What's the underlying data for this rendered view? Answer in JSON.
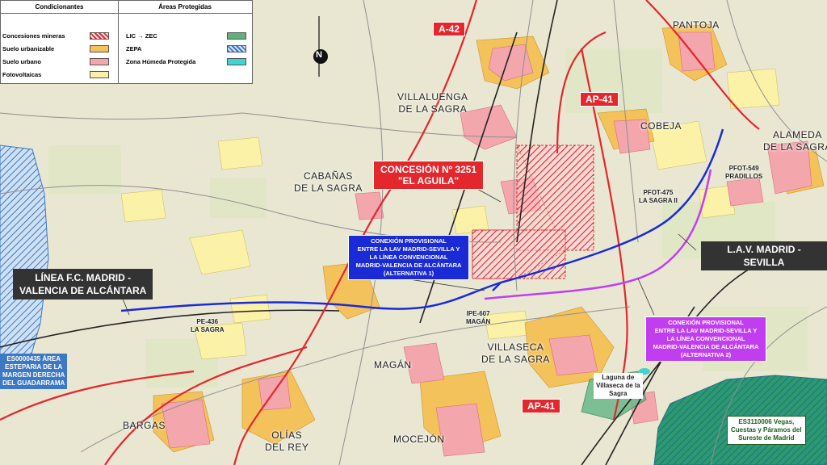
{
  "legend": {
    "header_left": "Condicionantes",
    "header_right": "Áreas Protegidas",
    "left_items": [
      {
        "label": "Concesiones mineras",
        "color": "#e4262d",
        "icon": "hatch-red"
      },
      {
        "label": "Suelo urbanizable",
        "color": "#f4c25a",
        "icon": "fill-orange"
      },
      {
        "label": "Suelo urbano",
        "color": "#f4a6ad",
        "icon": "fill-pink"
      },
      {
        "label": "Fotovoltaicas",
        "color": "#fbf2a8",
        "icon": "fill-yellow"
      }
    ],
    "right_items": [
      {
        "label": "LIC → ZEC",
        "color": "#5fb37a",
        "icon": "fill-green"
      },
      {
        "label": "ZEPA",
        "color": "#4f86c6",
        "icon": "hatch-blue"
      },
      {
        "label": "Zona Húmeda Protegida",
        "color": "#3fd3d3",
        "icon": "fill-cyan"
      }
    ]
  },
  "roads": {
    "a42": "A-42",
    "ap41_north": "AP-41",
    "ap41_south": "AP-41"
  },
  "towns": {
    "pantoja": "PANTOJA",
    "villaluenga": [
      "VILLALUENGA",
      "DE LA SAGRA"
    ],
    "cobeja": "COBEJA",
    "alameda": [
      "ALAMEDA",
      "DE LA SAGRA"
    ],
    "cabanas": [
      "CABAÑAS",
      "DE LA SAGRA"
    ],
    "magan": "MAGÁN",
    "villaseca": [
      "VILLASECA",
      "DE LA SAGRA"
    ],
    "bargas": "BARGAS",
    "olias": [
      "OLÍAS",
      "DEL REY"
    ],
    "mocejon": "MOCEJÓN"
  },
  "concession": {
    "title": "CONCESIÓN Nº 3251",
    "subtitle": "\"EL AGUILA\""
  },
  "lines": {
    "madrid_valencia": [
      "LÍNEA F.C. MADRID -",
      "VALENCIA DE ALCÁNTARA"
    ],
    "lav": "L.A.V. MADRID - SEVILLA"
  },
  "alternative1": {
    "text": [
      "CONEXIÓN PROVISIONAL",
      "ENTRE LA LAV MADRID-SEVILLA Y",
      "LA LÍNEA CONVENCIONAL",
      "MADRID-VALENCIA DE ALCÁNTARA",
      "(ALTERNATIVA 1)"
    ],
    "color": "#1a2bd6"
  },
  "alternative2": {
    "text": [
      "CONEXIÓN PROVISIONAL",
      "ENTRE LA LAV MADRID-SEVILLA Y",
      "LA LÍNEA CONVENCIONAL",
      "MADRID-VALENCIA DE ALCÁNTARA",
      "(ALTERNATIVA 2)"
    ],
    "color": "#c13ef0"
  },
  "small_labels": {
    "pfot549": [
      "PFOT-549",
      "PRADILLOS"
    ],
    "pfot475": [
      "PFOT-475",
      "LA SAGRA II"
    ],
    "ipe607": [
      "IPE-607",
      "MAGÁN"
    ],
    "pe436": [
      "PE-436",
      "LA SAGRA"
    ],
    "laguna": [
      "Laguna de",
      "Villaseca de la",
      "Sagra"
    ]
  },
  "protected": {
    "es0000435": [
      "ES0000435 ÁREA",
      "ESTEPARIA DE LA",
      "MARGEN DERECHA",
      "DEL GUADARRAMA"
    ],
    "es3110006": [
      "ES3110006 Vegas,",
      "Cuestas y Páramos del",
      "Sureste de Madrid"
    ]
  },
  "north_arrow": "N"
}
